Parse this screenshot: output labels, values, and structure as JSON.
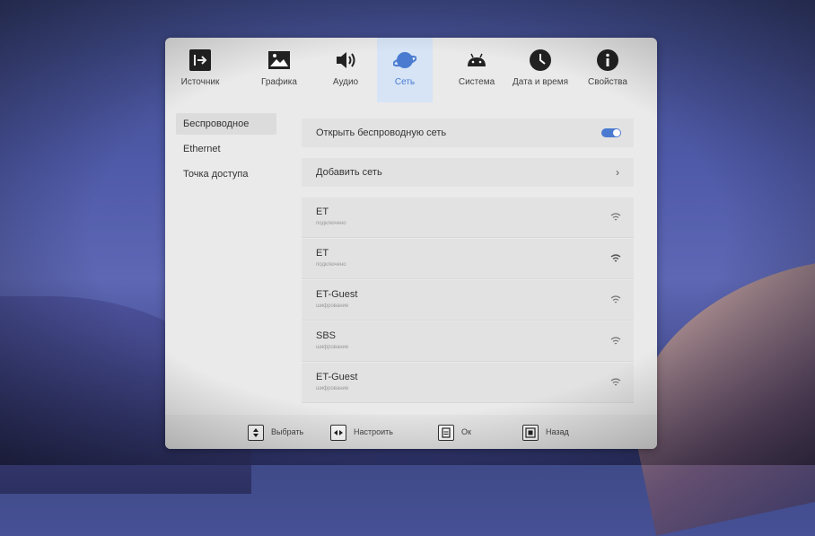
{
  "tabs": [
    {
      "label": "Источник",
      "icon": "source-input-icon"
    },
    {
      "label": "Графика",
      "icon": "picture-icon"
    },
    {
      "label": "Аудио",
      "icon": "speaker-icon"
    },
    {
      "label": "Сеть",
      "icon": "planet-network-icon",
      "active": true
    },
    {
      "label": "Система",
      "icon": "android-icon"
    },
    {
      "label": "Дата и время",
      "icon": "clock-icon"
    },
    {
      "label": "Свойства",
      "icon": "info-icon"
    }
  ],
  "sidebar": {
    "items": [
      {
        "label": "Беспроводное",
        "active": true
      },
      {
        "label": "Ethernet"
      },
      {
        "label": "Точка доступа"
      }
    ]
  },
  "wireless": {
    "open_label": "Открыть беспроводную сеть",
    "open_enabled": true,
    "add_label": "Добавить сеть",
    "add_chevron": "›"
  },
  "networks": [
    {
      "ssid": "ET",
      "status": "подключено"
    },
    {
      "ssid": "ET",
      "status": "подключено"
    },
    {
      "ssid": "ET-Guest",
      "status": "шифрование"
    },
    {
      "ssid": "SBS",
      "status": "шифрование"
    },
    {
      "ssid": "ET-Guest",
      "status": "шифрование"
    }
  ],
  "footer": {
    "select": "Выбрать",
    "adjust": "Настроить",
    "ok": "Ок",
    "back": "Назад"
  },
  "colors": {
    "accent": "#4a7bd0",
    "panel": "#eaeaea"
  }
}
